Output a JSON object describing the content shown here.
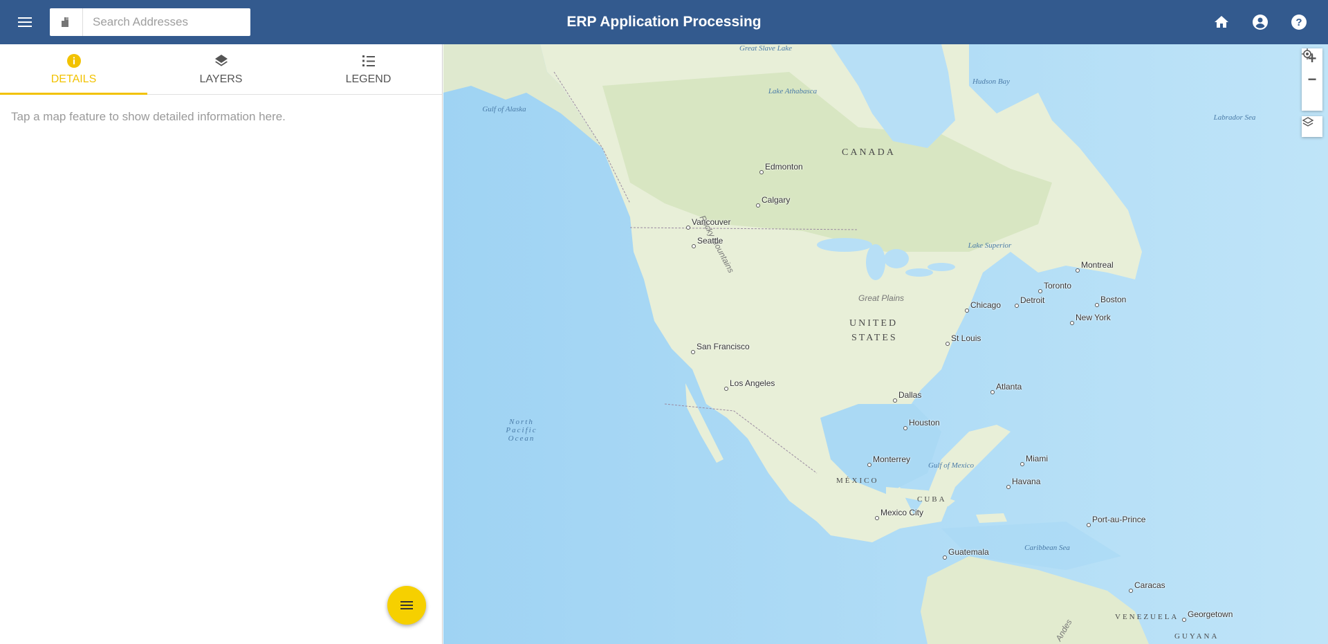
{
  "header": {
    "title": "ERP Application Processing",
    "search_placeholder": "Search Addresses",
    "menu_icon": "hamburger-menu-icon",
    "home_icon": "home-icon",
    "account_icon": "account-circle-icon",
    "help_icon": "help-icon"
  },
  "sidebar": {
    "tabs": [
      {
        "label": "DETAILS",
        "icon": "info-icon",
        "active": true
      },
      {
        "label": "LAYERS",
        "icon": "layers-icon",
        "active": false
      },
      {
        "label": "LEGEND",
        "icon": "list-icon",
        "active": false
      }
    ],
    "details_text": "Tap a map feature to show detailed information here."
  },
  "colors": {
    "header_bg": "#335a8e",
    "accent": "#f2c200",
    "fab": "#f6d000"
  },
  "map": {
    "countries": [
      "CANADA",
      "UNITED",
      "STATES",
      "MÉXICO",
      "CUBA",
      "VENEZUELA",
      "GUYANA"
    ],
    "cities": [
      "Edmonton",
      "Calgary",
      "Vancouver",
      "Seattle",
      "Montreal",
      "Toronto",
      "Boston",
      "Chicago",
      "Detroit",
      "New York",
      "St Louis",
      "San Francisco",
      "Los Angeles",
      "Dallas",
      "Atlanta",
      "Houston",
      "Monterrey",
      "Miami",
      "Havana",
      "Mexico City",
      "Port-au-Prince",
      "Guatemala",
      "Caracas",
      "Georgetown"
    ],
    "water": [
      "Great Slave Lake",
      "Hudson Bay",
      "Lake Athabasca",
      "Gulf of Alaska",
      "Labrador Sea",
      "Lake Superior",
      "North Pacific Ocean",
      "Gulf of Mexico",
      "Caribbean Sea"
    ],
    "regions": [
      "Rocky Mountains",
      "Great Plains",
      "Andes"
    ]
  }
}
